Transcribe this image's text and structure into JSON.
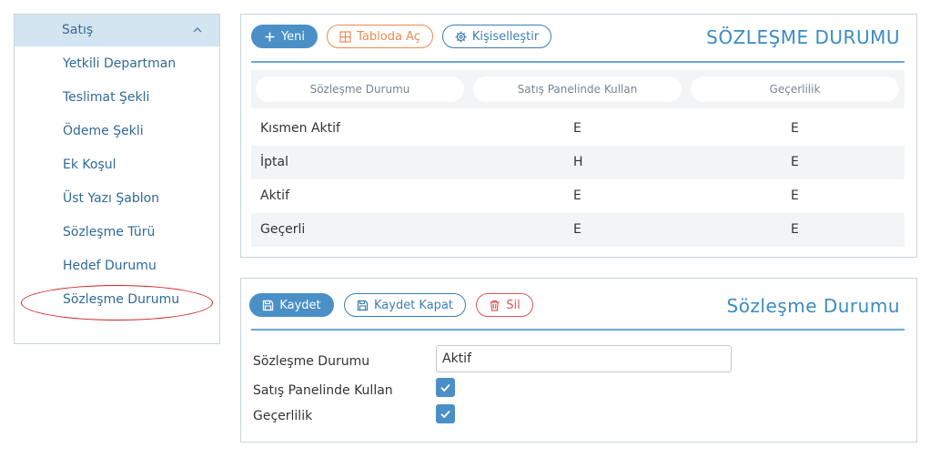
{
  "sidebar": {
    "section": {
      "label": "Satış",
      "icon": "chevron-up-icon"
    },
    "items": [
      {
        "label": "Yetkili Departman"
      },
      {
        "label": "Teslimat Şekli"
      },
      {
        "label": "Ödeme Şekli"
      },
      {
        "label": "Ek Koşul"
      },
      {
        "label": "Üst Yazı Şablon"
      },
      {
        "label": "Sözleşme Türü"
      },
      {
        "label": "Hedef Durumu"
      },
      {
        "label": "Sözleşme Durumu",
        "highlighted": true
      }
    ]
  },
  "list_panel": {
    "title": "SÖZLEŞME DURUMU",
    "toolbar": {
      "new_label": "Yeni",
      "open_table_label": "Tabloda Aç",
      "customize_label": "Kişiselleştir"
    },
    "table": {
      "columns": [
        "Sözleşme Durumu",
        "Satış Panelinde Kullan",
        "Geçerlilik"
      ],
      "rows": [
        [
          "Kısmen Aktif",
          "E",
          "E"
        ],
        [
          "İptal",
          "H",
          "E"
        ],
        [
          "Aktif",
          "E",
          "E"
        ],
        [
          "Geçerli",
          "E",
          "E"
        ]
      ]
    }
  },
  "form_panel": {
    "title": "Sözleşme Durumu",
    "toolbar": {
      "save_label": "Kaydet",
      "save_close_label": "Kaydet Kapat",
      "delete_label": "Sil"
    },
    "fields": {
      "status_label": "Sözleşme Durumu",
      "status_value": "Aktif",
      "sales_panel_label": "Satış Panelinde Kullan",
      "sales_panel_checked": true,
      "validity_label": "Geçerlilik",
      "validity_checked": true
    }
  },
  "colors": {
    "accent": "#4a90c7",
    "title": "#3a8cc4",
    "orange": "#ef8a50",
    "danger": "#e0575a",
    "highlight_ring": "#cc2222"
  }
}
